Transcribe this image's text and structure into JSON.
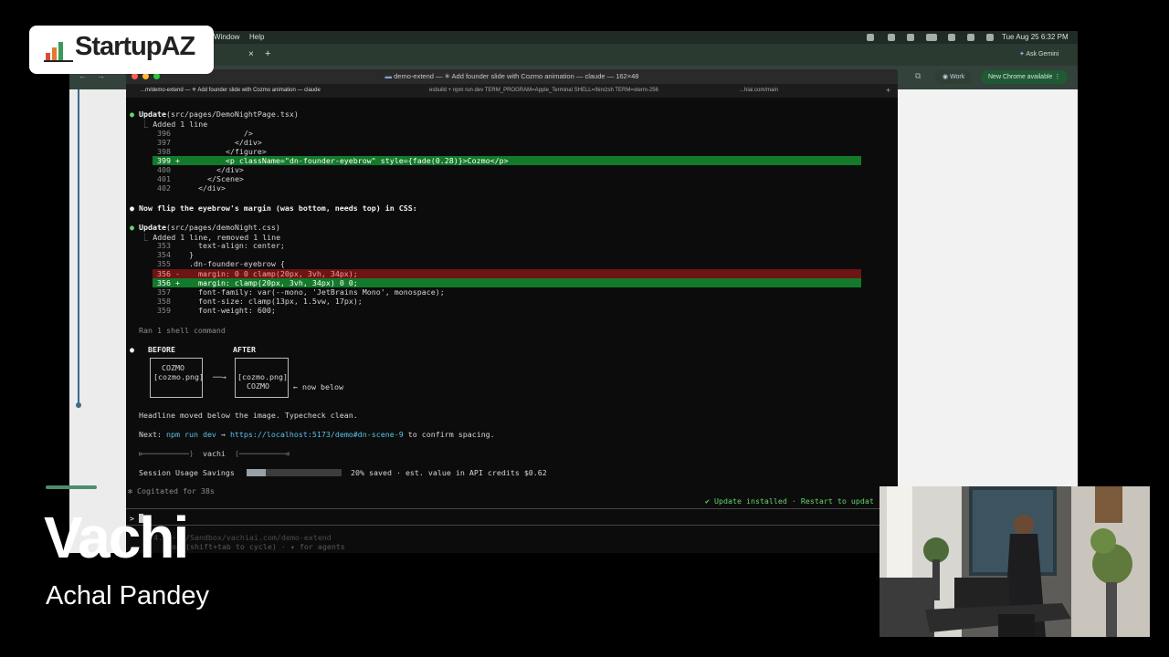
{
  "menubar": {
    "window": "Window",
    "help": "Help",
    "datetime": "Tue Aug 25  6:32 PM"
  },
  "chrome": {
    "ask_gemini": "Ask Gemini",
    "profile": "Work",
    "update_chip": "New Chrome available"
  },
  "terminal": {
    "title": "demo-extend — ✳ Add founder slide with Cozmo animation — claude — 162×48",
    "tabs": [
      "...m/demo-extend — ✳ Add founder slide with Cozmo animation — claude",
      "esbuild + npm run dev TERM_PROGRAM=Apple_Terminal SHELL=/bin/zsh TERM=xterm-256",
      "...hiai.com/main"
    ],
    "update1_label": "Update",
    "update1_file": "(src/pages/DemoNightPage.tsx)",
    "update1_summary": "Added 1 line",
    "diff1": [
      {
        "num": "396",
        "code": "              />"
      },
      {
        "num": "397",
        "code": "            </div>"
      },
      {
        "num": "398",
        "code": "          </figure>"
      },
      {
        "num": "399 +",
        "code": "          <p className=\"dn-founder-eyebrow\" style={fade(0.28)}>Cozmo</p>"
      },
      {
        "num": "400",
        "code": "        </div>"
      },
      {
        "num": "401",
        "code": "      </Scene>"
      },
      {
        "num": "402",
        "code": "    </div>"
      }
    ],
    "note1": "Now flip the eyebrow's margin (was bottom, needs top) in CSS:",
    "update2_label": "Update",
    "update2_file": "(src/pages/demoNight.css)",
    "update2_summary": "Added 1 line, removed 1 line",
    "diff2": [
      {
        "num": "353",
        "code": "    text-align: center;"
      },
      {
        "num": "354",
        "code": "  }"
      },
      {
        "num": "355",
        "code": "  .dn-founder-eyebrow {"
      },
      {
        "num": "356 -",
        "code": "    margin: 0 0 clamp(20px, 3vh, 34px);"
      },
      {
        "num": "356 +",
        "code": "    margin: clamp(20px, 3vh, 34px) 0 0;"
      },
      {
        "num": "357",
        "code": "    font-family: var(--mono, 'JetBrains Mono', monospace);"
      },
      {
        "num": "358",
        "code": "    font-size: clamp(13px, 1.5vw, 17px);"
      },
      {
        "num": "359",
        "code": "    font-weight: 600;"
      }
    ],
    "ran_shell": "Ran 1 shell command",
    "before_label": "BEFORE",
    "after_label": "AFTER",
    "before_box": [
      "COZMO",
      "[cozmo.png]"
    ],
    "after_box": [
      "[cozmo.png]",
      "COZMO"
    ],
    "arrow": "──→",
    "now_below": "← now below",
    "headline_note": "Headline moved below the image. Typecheck clean.",
    "next_label": "Next:",
    "next_cmd": "npm run dev",
    "next_arrow": "→",
    "next_url": "https://localhost:5173/demo#dn-scene-9",
    "next_tail": "to confirm spacing.",
    "divider_left": "⊳──────────⟩",
    "divider_name": "vachi",
    "divider_right": "⟨──────────⊲",
    "usage_label": "Session Usage Savings",
    "usage_fraction": 0.2,
    "usage_text": "20% saved · est. value in API credits $0.62",
    "cogitated": "✻ Cogitated for 38s",
    "update_installed": "✔ Update installed · Restart to updat",
    "prompt": ">",
    "footer1": "  4.0 · ~/Sandbox/vachiai.com/demo-extend",
    "footer2": "  on (shift+tab to cycle) · ✦ for agents"
  },
  "overlay": {
    "logo_text": "StartupAZ",
    "presenter": "Vachi",
    "name": "Achal Pandey"
  }
}
